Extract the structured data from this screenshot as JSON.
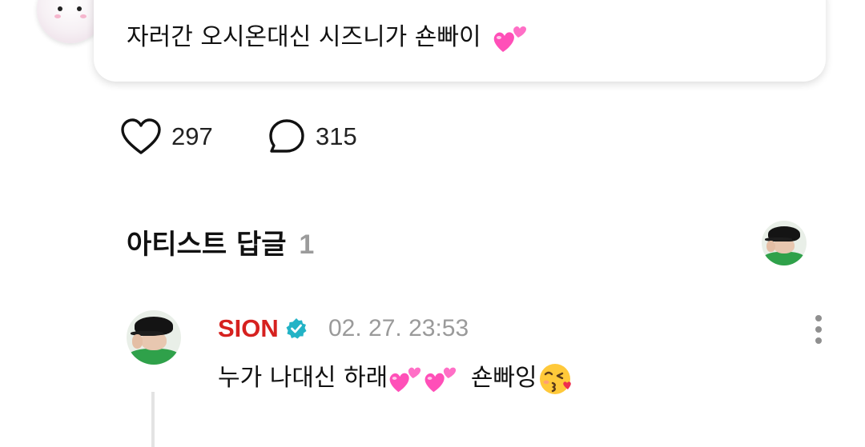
{
  "post": {
    "text": "자러간 오시온대신 시즈니가 숀빠이",
    "emoji": "two-hearts"
  },
  "stats": {
    "likes": "297",
    "comments": "315"
  },
  "artist_replies": {
    "title": "아티스트 답글",
    "count": "1"
  },
  "reply": {
    "author": "SION",
    "verified": true,
    "timestamp": "02. 27. 23:53",
    "text_part1": "누가 나대신 하래",
    "text_part2": "숀빠잉",
    "emojis": [
      "two-hearts",
      "two-hearts",
      "face-blowing-a-kiss"
    ]
  },
  "colors": {
    "author_red": "#d6211f",
    "verified_teal": "#22b3c6",
    "muted_gray": "#9a9a9a",
    "heart_pink": "#ff4fb8"
  }
}
